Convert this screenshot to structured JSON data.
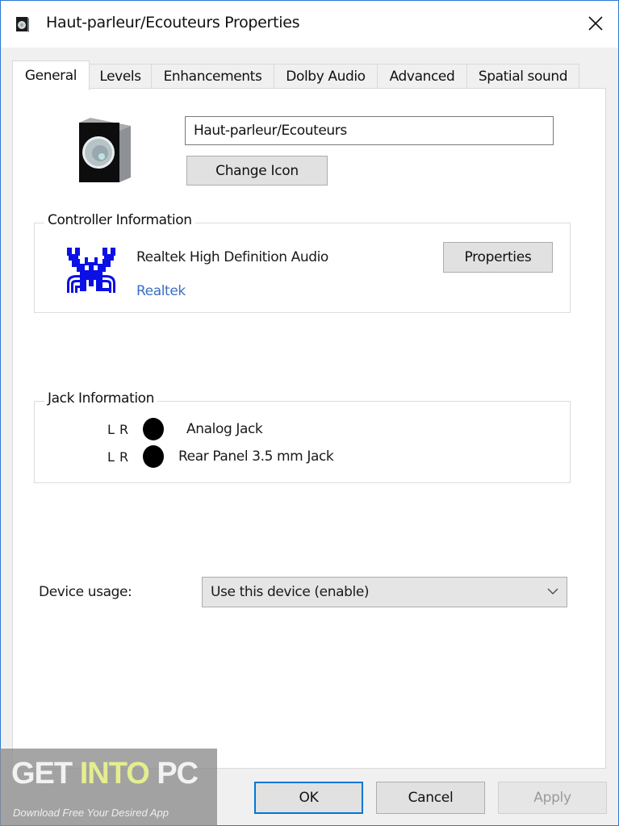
{
  "window": {
    "title": "Haut-parleur/Ecouteurs Properties",
    "title_icon": "speaker-icon",
    "close_icon": "close-icon"
  },
  "tabs": [
    {
      "label": "General",
      "active": true
    },
    {
      "label": "Levels",
      "active": false
    },
    {
      "label": "Enhancements",
      "active": false
    },
    {
      "label": "Dolby Audio",
      "active": false
    },
    {
      "label": "Advanced",
      "active": false
    },
    {
      "label": "Spatial sound",
      "active": false
    }
  ],
  "general": {
    "device_icon": "speaker-icon",
    "device_name_value": "Haut-parleur/Ecouteurs",
    "change_icon_label": "Change Icon",
    "controller": {
      "group_title": "Controller Information",
      "logo_icon": "realtek-crab-logo",
      "name": "Realtek High Definition Audio",
      "vendor_link": "Realtek",
      "properties_label": "Properties",
      "link_color": "#3b6fc4"
    },
    "jack": {
      "group_title": "Jack Information",
      "rows": [
        {
          "channels": "L R",
          "color": "#000000",
          "label": "Analog Jack"
        },
        {
          "channels": "L R",
          "color": "#000000",
          "label": "Rear Panel 3.5 mm Jack"
        }
      ]
    },
    "device_usage": {
      "label": "Device usage:",
      "selected": "Use this device (enable)"
    }
  },
  "footer": {
    "ok_label": "OK",
    "cancel_label": "Cancel",
    "apply_label": "Apply",
    "apply_enabled": false,
    "accent_color": "#0078d7"
  },
  "watermark": {
    "part1": "GET ",
    "part2": "INTO",
    "part3": " PC",
    "tagline": "Download Free Your Desired App"
  }
}
